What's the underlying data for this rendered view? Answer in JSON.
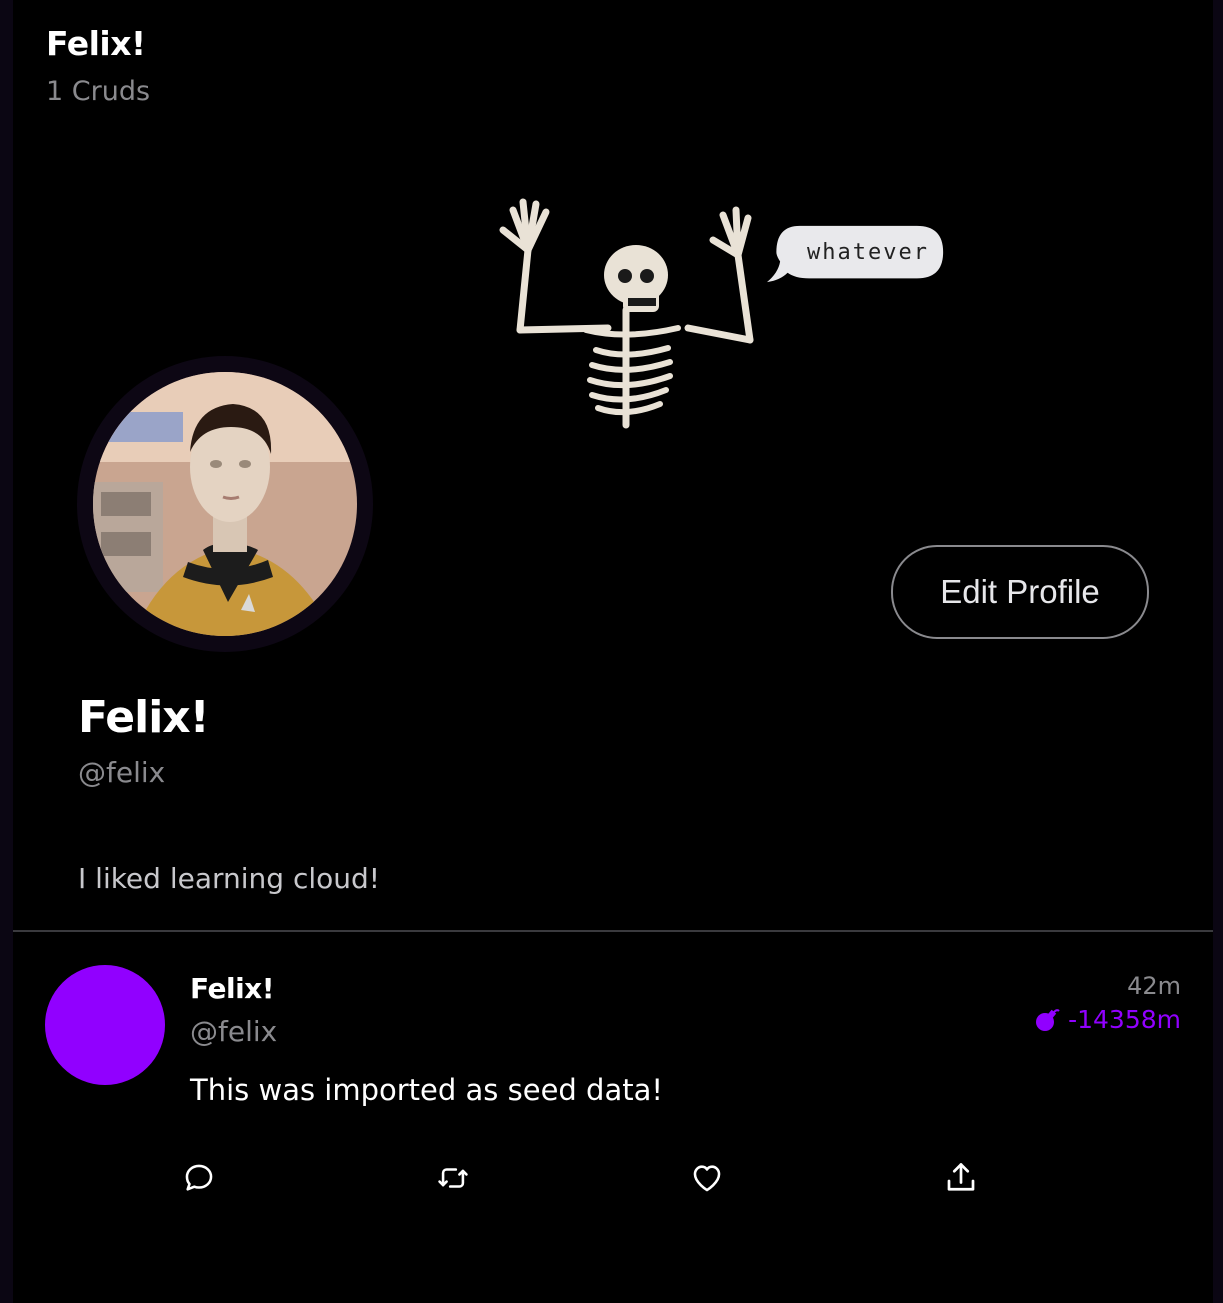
{
  "header": {
    "title": "Felix!",
    "count_label": "1 Cruds"
  },
  "banner": {
    "speech_bubble": "whatever"
  },
  "profile": {
    "name": "Felix!",
    "handle": "@felix",
    "bio": "I liked learning cloud!",
    "edit_button": "Edit Profile"
  },
  "post": {
    "name": "Felix!",
    "handle": "@felix",
    "time": "42m",
    "expiry": "-14358m",
    "text": "This was imported as seed data!",
    "avatar_color": "#9100ff"
  },
  "actions": [
    {
      "icon": "comment-icon"
    },
    {
      "icon": "retweet-icon"
    },
    {
      "icon": "heart-icon"
    },
    {
      "icon": "share-icon"
    }
  ],
  "colors": {
    "accent": "#9100ff",
    "muted": "#8a8a8e",
    "background": "#000000"
  }
}
